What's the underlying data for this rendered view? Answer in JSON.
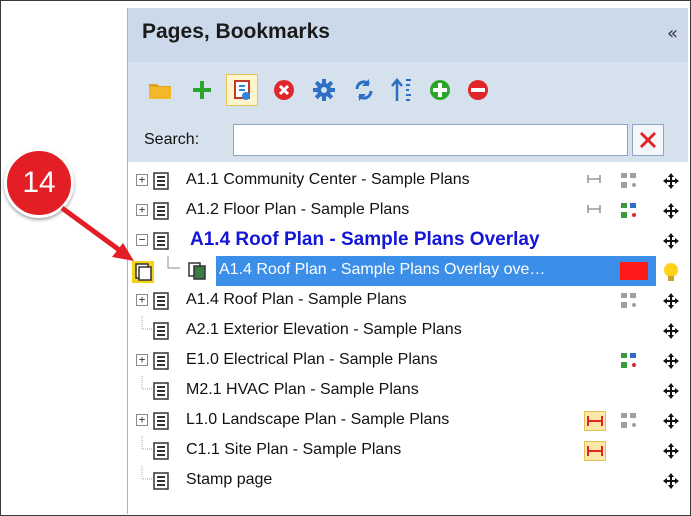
{
  "panel": {
    "title": "Pages, Bookmarks",
    "collapse_glyph": "«"
  },
  "toolbar": {
    "buttons": [
      {
        "name": "open-folder-icon"
      },
      {
        "name": "add-icon"
      },
      {
        "name": "page-overlay-icon",
        "selected": true
      },
      {
        "name": "delete-icon"
      },
      {
        "name": "settings-icon"
      },
      {
        "name": "refresh-icon"
      },
      {
        "name": "sort-icon"
      },
      {
        "name": "expand-all-icon"
      },
      {
        "name": "collapse-all-icon"
      }
    ]
  },
  "search": {
    "label": "Search:",
    "value": "",
    "placeholder": ""
  },
  "tree": {
    "items": [
      {
        "label": "A1.1 Community Center - Sample Plans"
      },
      {
        "label": "A1.2 Floor Plan - Sample Plans"
      },
      {
        "label": "A1.4 Roof Plan - Sample Plans Overlay"
      },
      {
        "label": "A1.4 Roof Plan - Sample Plans Overlay ove…",
        "selected": true
      },
      {
        "label": "A1.4 Roof Plan - Sample Plans"
      },
      {
        "label": "A2.1 Exterior Elevation - Sample Plans"
      },
      {
        "label": "E1.0 Electrical Plan - Sample Plans"
      },
      {
        "label": "M2.1 HVAC Plan - Sample Plans"
      },
      {
        "label": "L1.0 Landscape Plan - Sample Plans"
      },
      {
        "label": "C1.1 Site Plan - Sample Plans"
      },
      {
        "label": "Stamp page"
      }
    ],
    "expander_glyph": "+",
    "collapse_glyph": "−"
  },
  "callout": {
    "number": "14"
  },
  "colors": {
    "header_bg": "#ccd9ea",
    "selection": "#3b8fe8",
    "overlay_title": "#1515d6",
    "callout": "#e31e24"
  }
}
